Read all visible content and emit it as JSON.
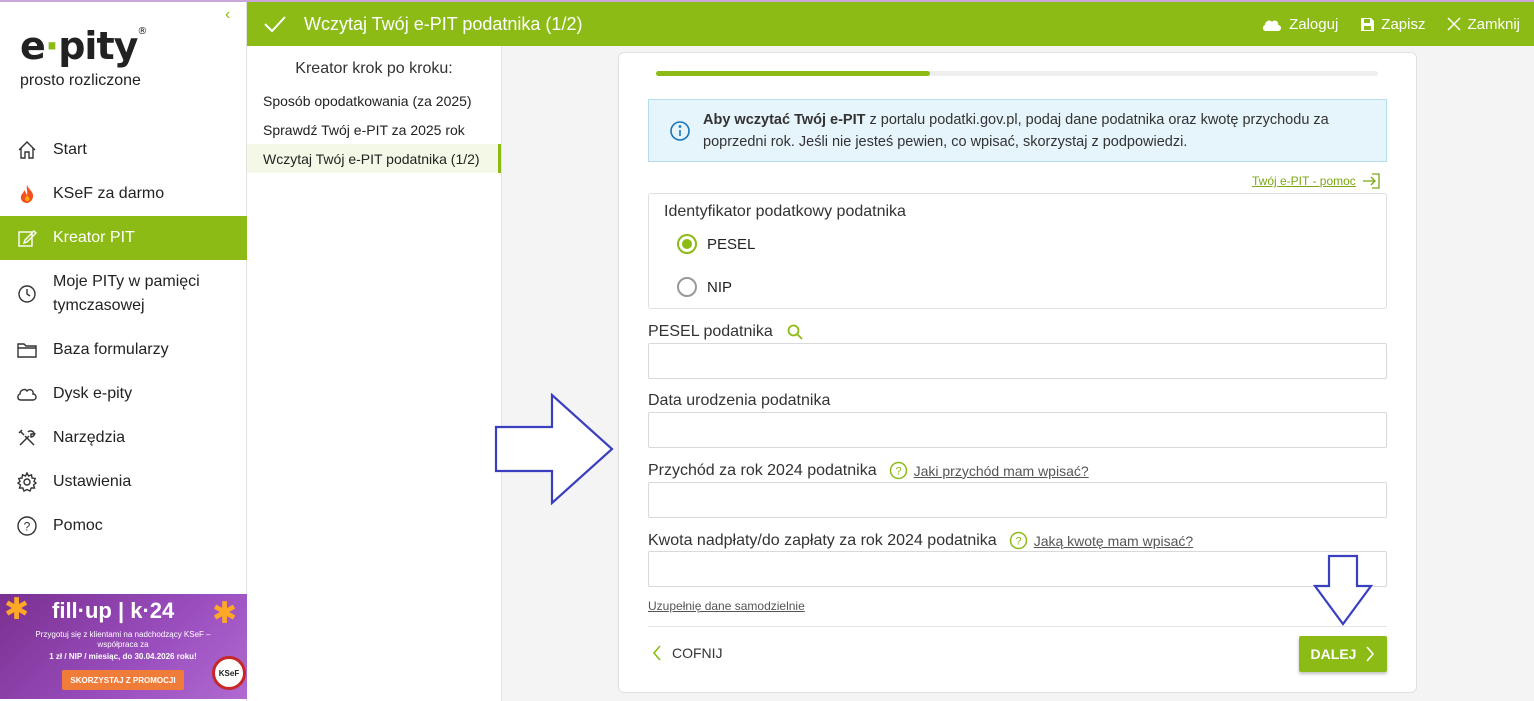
{
  "brand": {
    "logo_e": "e",
    "logo_rest": "pity",
    "tagline": "prosto rozliczone"
  },
  "sidebar": {
    "items": [
      {
        "label": "Start",
        "icon": "home-icon"
      },
      {
        "label": "KSeF za darmo",
        "icon": "fire-icon"
      },
      {
        "label": "Kreator PIT",
        "icon": "edit-icon",
        "active": true
      },
      {
        "label": "Moje PITy w pamięci tymczasowej",
        "icon": "clock-icon"
      },
      {
        "label": "Baza formularzy",
        "icon": "folder-icon"
      },
      {
        "label": "Dysk e-pity",
        "icon": "cloud-icon"
      },
      {
        "label": "Narzędzia",
        "icon": "tools-icon"
      },
      {
        "label": "Ustawienia",
        "icon": "gear-icon"
      },
      {
        "label": "Pomoc",
        "icon": "help-icon"
      }
    ],
    "promo": {
      "title": "fill·up | k·24",
      "text": "Przygotuj się z klientami na nadchodzący KSeF – współpraca za",
      "price": "1 zł / NIP / miesiąc, do 30.04.2026 roku!",
      "button": "SKORZYSTAJ Z PROMOCJI",
      "badge": "KSeF"
    }
  },
  "header": {
    "title": "Wczytaj Twój e-PIT podatnika (1/2)",
    "login": "Zaloguj",
    "save": "Zapisz",
    "close": "Zamknij"
  },
  "steps": {
    "heading": "Kreator krok po kroku:",
    "items": [
      "Sposób opodatkowania (za 2025)",
      "Sprawdź Twój e-PIT za 2025 rok",
      "Wczytaj Twój e-PIT podatnika (1/2)"
    ]
  },
  "form": {
    "progress": 0.38,
    "info_bold": "Aby wczytać Twój e-PIT",
    "info_text": " z portalu podatki.gov.pl, podaj dane podatnika oraz kwotę przychodu za poprzedni rok. Jeśli nie jesteś pewien, co wpisać, skorzystaj z podpowiedzi.",
    "help_link": "Twój e-PIT - pomoc",
    "id_label": "Identyfikator podatkowy podatnika",
    "radio_pesel": "PESEL",
    "radio_nip": "NIP",
    "pesel_label": "PESEL podatnika",
    "birth_label": "Data urodzenia podatnika",
    "income_label": "Przychód za rok 2024 podatnika",
    "income_hint": "Jaki przychód mam wpisać?",
    "amount_label": "Kwota nadpłaty/do zapłaty za rok 2024 podatnika",
    "amount_hint": "Jaką kwotę mam wpisać?",
    "self_link": "Uzupełnię dane samodzielnie",
    "back": "COFNIJ",
    "next": "DALEJ"
  },
  "colors": {
    "accent": "#8bbb14",
    "annotation": "#3a3fbf"
  }
}
